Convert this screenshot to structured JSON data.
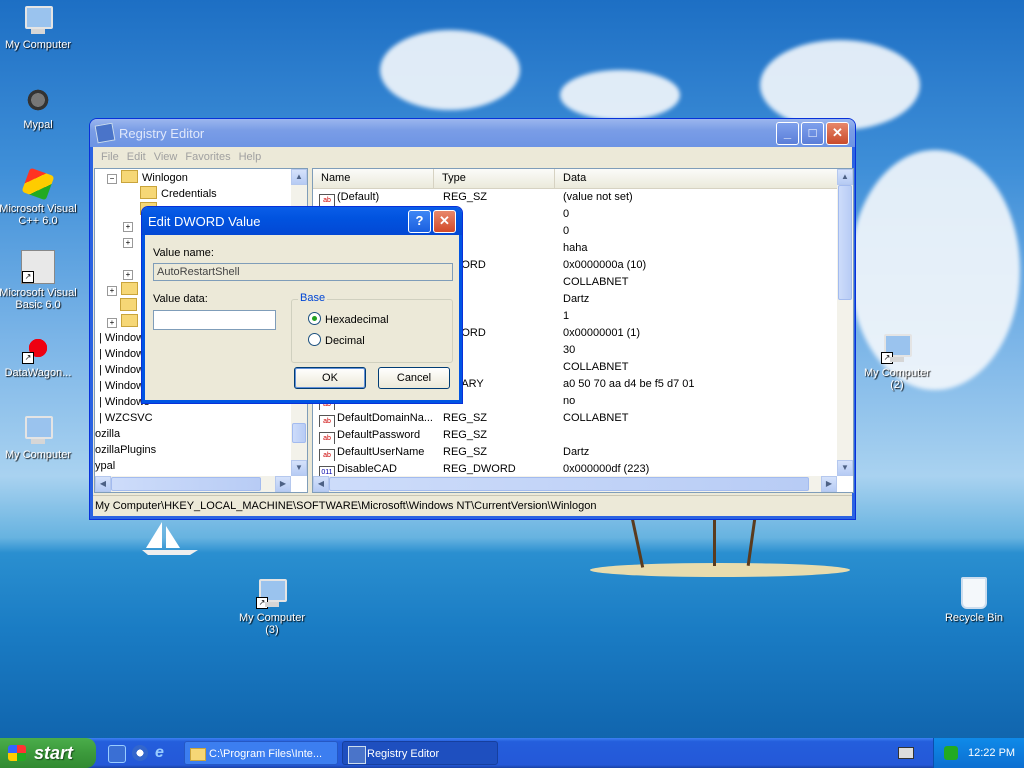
{
  "desktop": {
    "icons": [
      {
        "label": "My Computer"
      },
      {
        "label": "Mypal"
      },
      {
        "label": "Microsoft Visual C++ 6.0"
      },
      {
        "label": "Microsoft Visual Basic 6.0"
      },
      {
        "label": "DataWagon..."
      },
      {
        "label": "My Computer"
      },
      {
        "label": "My Computer (2)"
      },
      {
        "label": "My Computer (3)"
      },
      {
        "label": "Recycle Bin"
      }
    ]
  },
  "registry": {
    "title": "Registry Editor",
    "menu": [
      "File",
      "Edit",
      "View",
      "Favorites",
      "Help"
    ],
    "tree": [
      {
        "label": "Winlogon",
        "expanded": true
      },
      {
        "label": "Credentials"
      },
      {
        "label": "Windows"
      },
      {
        "label": "Windows"
      },
      {
        "label": "Windows"
      },
      {
        "label": "Windows"
      },
      {
        "label": "Windows"
      },
      {
        "label": "WZCSVC"
      },
      {
        "label": "ozilla"
      },
      {
        "label": "ozillaPlugins"
      },
      {
        "label": "ypal"
      }
    ],
    "columns": [
      "Name",
      "Type",
      "Data"
    ],
    "rows": [
      {
        "name": "(Default)",
        "type": "REG_SZ",
        "data": "(value not set)"
      },
      {
        "name": "",
        "type": "SZ",
        "data": "0"
      },
      {
        "name": "",
        "type": "SZ",
        "data": "0"
      },
      {
        "name": "",
        "type": "SZ",
        "data": "haha"
      },
      {
        "name": "",
        "type": "DWORD",
        "data": "0x0000000a (10)"
      },
      {
        "name": "",
        "type": "SZ",
        "data": "COLLABNET"
      },
      {
        "name": "",
        "type": "SZ",
        "data": "Dartz"
      },
      {
        "name": "",
        "type": "SZ",
        "data": "1"
      },
      {
        "name": "",
        "type": "DWORD",
        "data": "0x00000001 (1)"
      },
      {
        "name": "",
        "type": "SZ",
        "data": "30"
      },
      {
        "name": "",
        "type": "SZ",
        "data": "COLLABNET"
      },
      {
        "name": "",
        "type": "BINARY",
        "data": "a0 50 70 aa d4 be f5 d7 01"
      },
      {
        "name": "",
        "type": "SZ",
        "data": "no"
      },
      {
        "name": "DefaultDomainNa...",
        "type": "REG_SZ",
        "data": "COLLABNET"
      },
      {
        "name": "DefaultPassword",
        "type": "REG_SZ",
        "data": ""
      },
      {
        "name": "DefaultUserName",
        "type": "REG_SZ",
        "data": "Dartz"
      },
      {
        "name": "DisableCAD",
        "type": "REG_DWORD",
        "data": "0x000000df (223)"
      }
    ],
    "status_path": "My Computer\\HKEY_LOCAL_MACHINE\\SOFTWARE\\Microsoft\\Windows NT\\CurrentVersion\\Winlogon"
  },
  "dialog": {
    "title": "Edit DWORD Value",
    "value_name_label": "Value name:",
    "value_name": "AutoRestartShell",
    "value_data_label": "Value data:",
    "value_data": "",
    "base_label": "Base",
    "hex_label": "Hexadecimal",
    "dec_label": "Decimal",
    "selected_base": "Hexadecimal",
    "ok_label": "OK",
    "cancel_label": "Cancel"
  },
  "taskbar": {
    "start_label": "start",
    "items": [
      {
        "label": "C:\\Program Files\\Inte..."
      },
      {
        "label": "Registry Editor"
      }
    ],
    "clock": "12:22 PM"
  }
}
